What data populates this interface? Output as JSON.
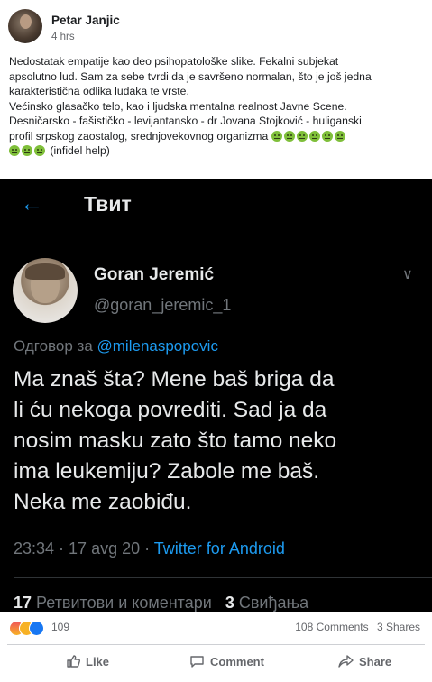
{
  "post": {
    "author": "Petar Janjic",
    "time": "4 hrs",
    "text_lines": [
      "Nedostatak empatije kao deo psihopatološke slike. Fekalni subjekat",
      "apsolutno lud. Sam za sebe tvrdi da je savršeno normalan, što je još jedna",
      "karakteristična odlika ludaka te vrste.",
      "Većinsko glasačko telo, kao i ljudska mentalna realnost Javne Scene.",
      "Desničarsko - fašističko - levijantansko - dr Jovana Stojković - huliganski",
      "profil srpskog zaostalog, srednjovekovnog organizma"
    ],
    "last_line_suffix": "(infidel help)",
    "emoji_icon": "nauseated-face-emoji"
  },
  "tweet": {
    "header_title": "Твит",
    "back_icon": "arrow-left-icon",
    "name": "Goran Jeremić",
    "handle": "@goran_jeremic_1",
    "reply_label": "Одговор за",
    "reply_to": "@milenaspopovic",
    "body_lines": [
      "Ma znaš šta? Mene baš briga da",
      "li ću nekoga povrediti. Sad ja da",
      "nosim masku zato što tamo neko",
      "ima leukemiju? Zabole me baš.",
      "Neka me zaobiđu."
    ],
    "timestamp": "23:34 · 17 avg 20 ·",
    "source": "Twitter for Android",
    "retweets_count": "17",
    "retweets_label": "Ретвитови и коментари",
    "likes_count": "3",
    "likes_label": "Свиђања"
  },
  "footer": {
    "reaction_count": "109",
    "comments": "108 Comments",
    "shares": "3 Shares",
    "like_label": "Like",
    "comment_label": "Comment",
    "share_label": "Share"
  },
  "colors": {
    "twitter_blue": "#1d9bf0",
    "facebook_blue": "#1877f2",
    "tweet_bg": "#000000"
  }
}
